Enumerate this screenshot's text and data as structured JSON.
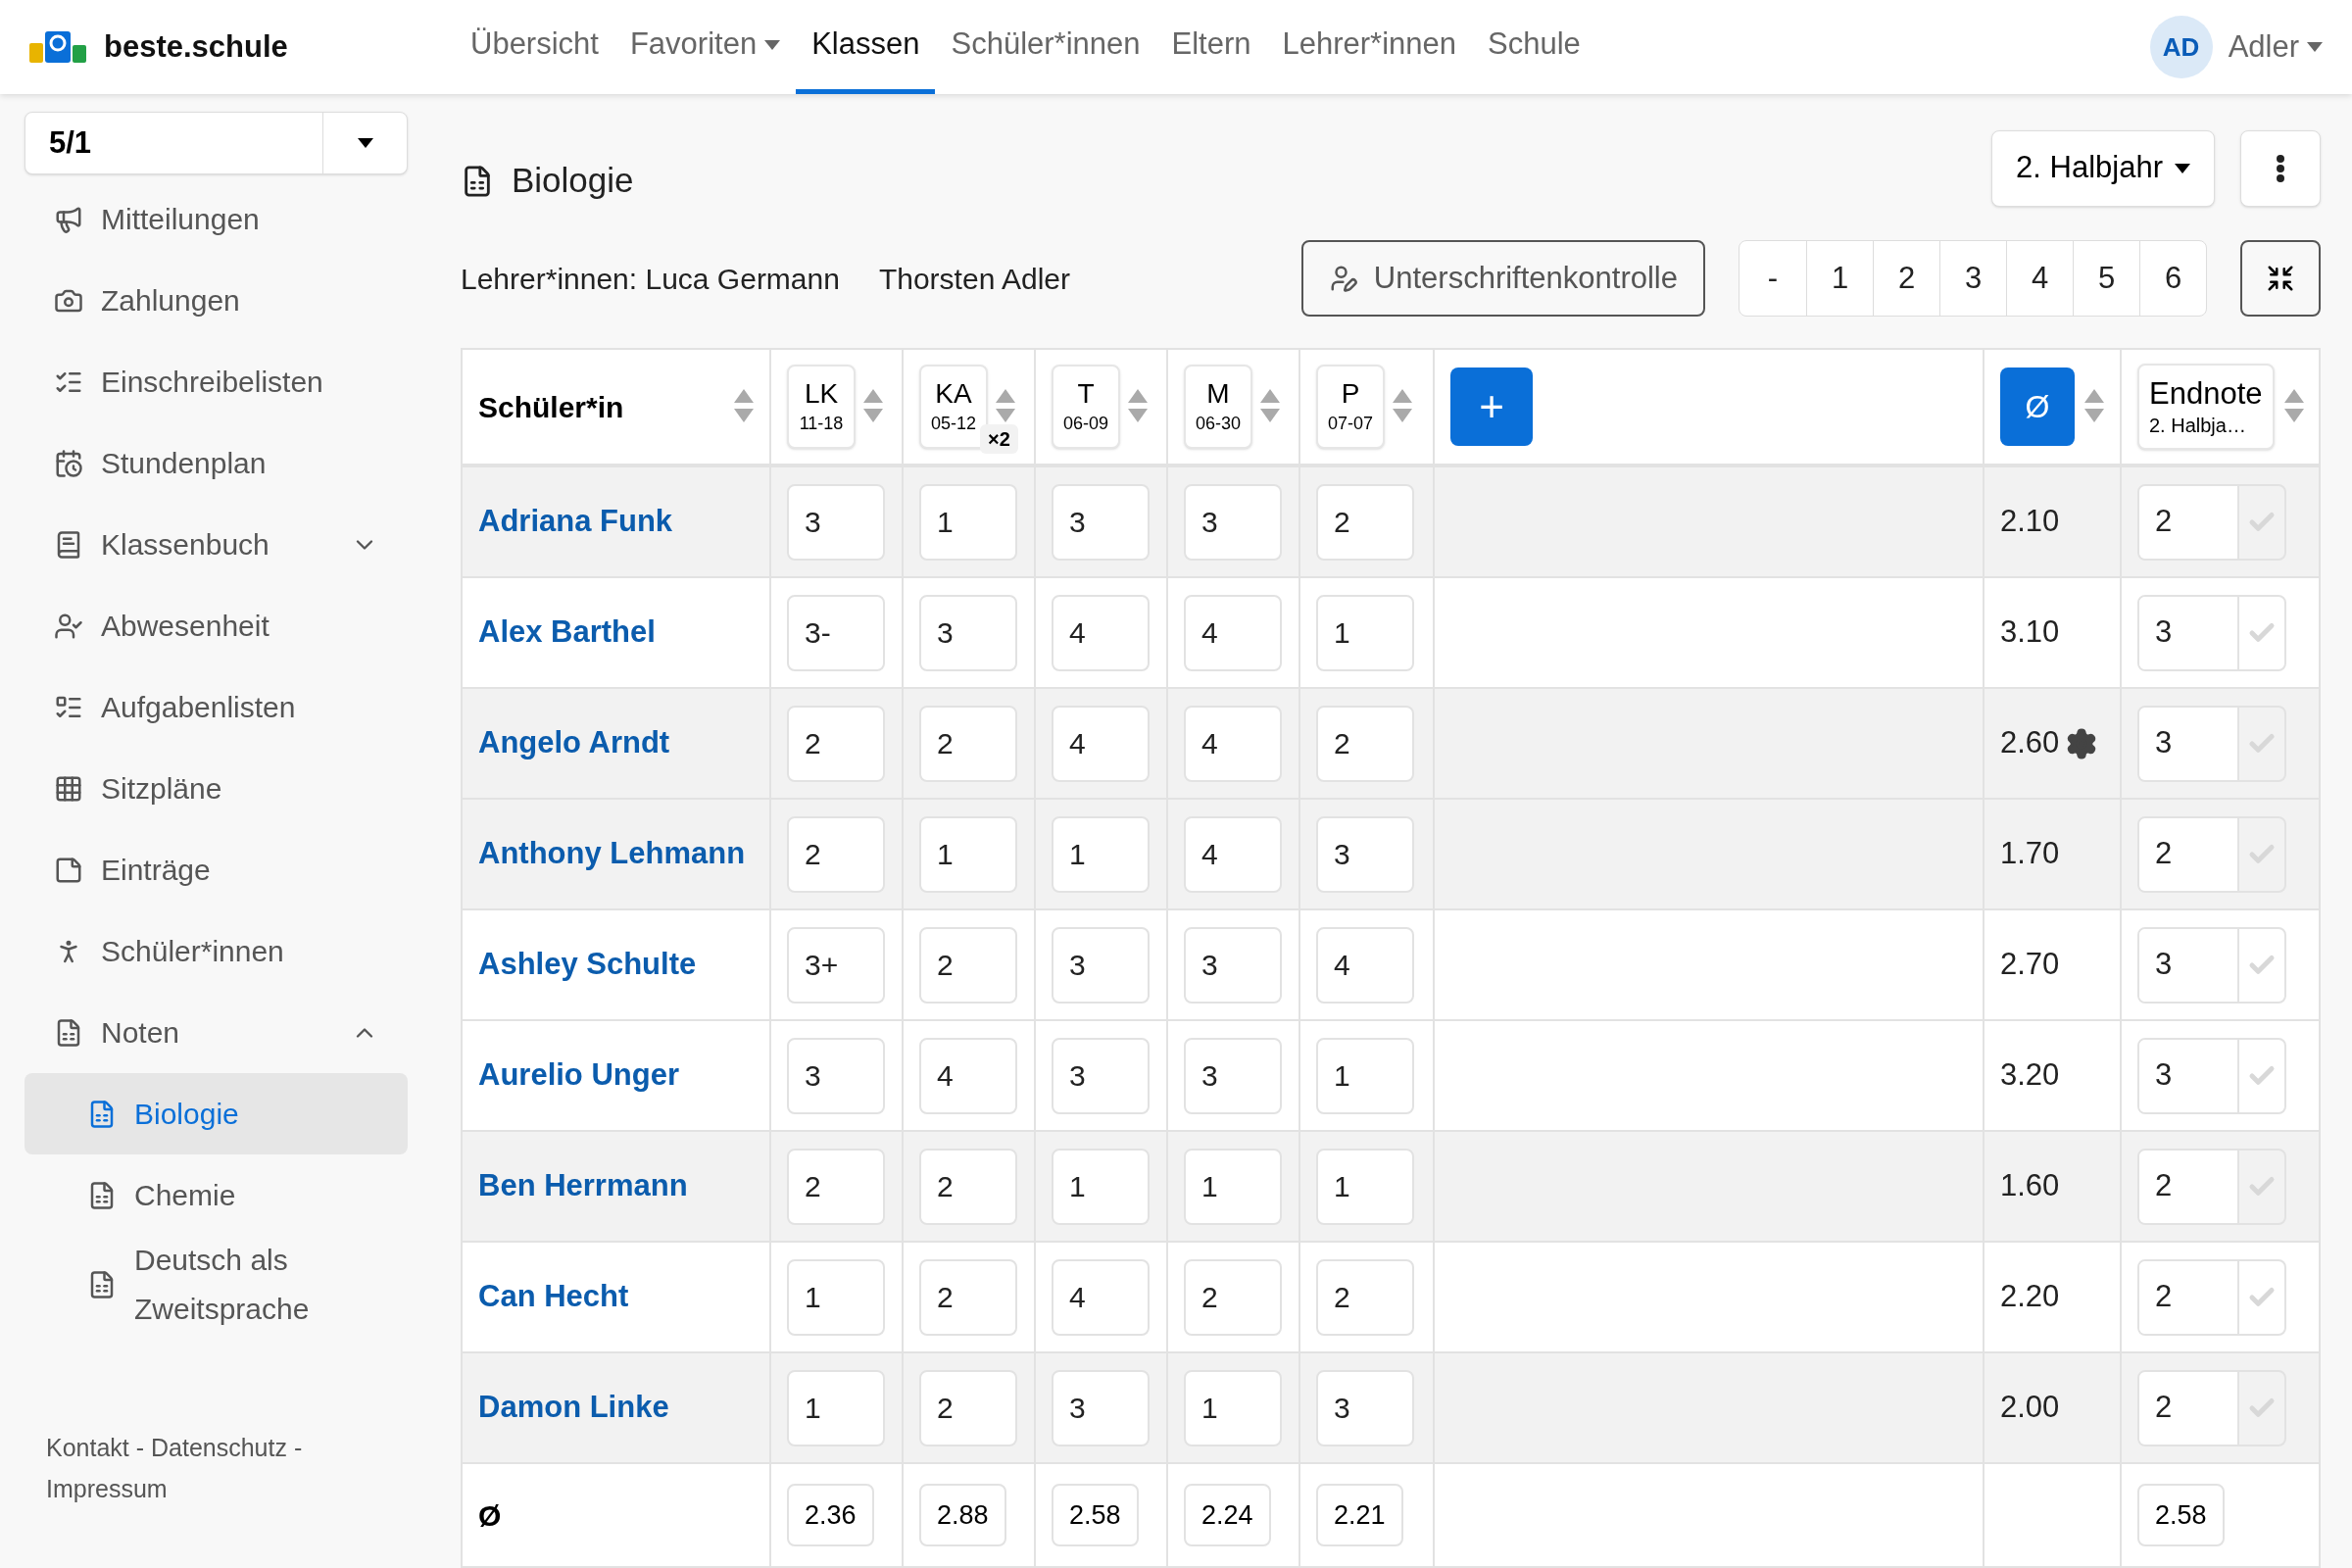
{
  "brand": {
    "name": "beste.schule"
  },
  "nav": [
    {
      "label": "Übersicht",
      "selected": false,
      "dropdown": false
    },
    {
      "label": "Favoriten",
      "selected": false,
      "dropdown": true
    },
    {
      "label": "Klassen",
      "selected": true,
      "dropdown": false
    },
    {
      "label": "Schüler*innen",
      "selected": false,
      "dropdown": false
    },
    {
      "label": "Eltern",
      "selected": false,
      "dropdown": false
    },
    {
      "label": "Lehrer*innen",
      "selected": false,
      "dropdown": false
    },
    {
      "label": "Schule",
      "selected": false,
      "dropdown": false
    }
  ],
  "user": {
    "initials": "AD",
    "name": "Adler"
  },
  "sidebar": {
    "class_select": "5/1",
    "items": [
      {
        "label": "Mitteilungen"
      },
      {
        "label": "Zahlungen"
      },
      {
        "label": "Einschreibelisten"
      },
      {
        "label": "Stundenplan"
      },
      {
        "label": "Klassenbuch",
        "expanded": false
      },
      {
        "label": "Abwesenheit"
      },
      {
        "label": "Aufgabenlisten"
      },
      {
        "label": "Sitzpläne"
      },
      {
        "label": "Einträge"
      },
      {
        "label": "Schüler*innen"
      },
      {
        "label": "Noten",
        "expanded": true,
        "children": [
          {
            "label": "Biologie",
            "selected": true
          },
          {
            "label": "Chemie",
            "selected": false
          },
          {
            "label": "Deutsch als Zweitsprache",
            "selected": false
          }
        ]
      }
    ],
    "footer": "Kontakt - Datenschutz - Impressum"
  },
  "page": {
    "title": "Biologie",
    "semester": "2. Halbjahr",
    "teachers": [
      "Lehrer*innen: Luca Germann",
      "Thorsten Adler"
    ],
    "signature_button": "Unterschriftenkontrolle",
    "pager": [
      "-",
      "1",
      "2",
      "3",
      "4",
      "5",
      "6"
    ]
  },
  "table": {
    "name_header": "Schüler*in",
    "grade_columns": [
      {
        "label": "LK",
        "date": "11-18"
      },
      {
        "label": "KA",
        "date": "05-12",
        "weight": "×2"
      },
      {
        "label": "T",
        "date": "06-09"
      },
      {
        "label": "M",
        "date": "06-30"
      },
      {
        "label": "P",
        "date": "07-07"
      }
    ],
    "add_button": "+",
    "average_header": "Ø",
    "final_header": {
      "label": "Endnote",
      "sub": "2. Halbja…"
    },
    "rows": [
      {
        "name": "Adriana Funk",
        "grades": [
          "3",
          "1",
          "3",
          "3",
          "2"
        ],
        "average": "2.10",
        "adjusted": false,
        "final": "2",
        "shaded": true
      },
      {
        "name": "Alex Barthel",
        "grades": [
          "3-",
          "3",
          "4",
          "4",
          "1"
        ],
        "average": "3.10",
        "adjusted": false,
        "final": "3",
        "shaded": false
      },
      {
        "name": "Angelo Arndt",
        "grades": [
          "2",
          "2",
          "4",
          "4",
          "2"
        ],
        "average": "2.60",
        "adjusted": true,
        "final": "3",
        "shaded": true
      },
      {
        "name": "Anthony Lehmann",
        "grades": [
          "2",
          "1",
          "1",
          "4",
          "3"
        ],
        "average": "1.70",
        "adjusted": false,
        "final": "2",
        "shaded": true
      },
      {
        "name": "Ashley Schulte",
        "grades": [
          "3+",
          "2",
          "3",
          "3",
          "4"
        ],
        "average": "2.70",
        "adjusted": false,
        "final": "3",
        "shaded": false
      },
      {
        "name": "Aurelio Unger",
        "grades": [
          "3",
          "4",
          "3",
          "3",
          "1"
        ],
        "average": "3.20",
        "adjusted": false,
        "final": "3",
        "shaded": false
      },
      {
        "name": "Ben Herrmann",
        "grades": [
          "2",
          "2",
          "1",
          "1",
          "1"
        ],
        "average": "1.60",
        "adjusted": false,
        "final": "2",
        "shaded": true
      },
      {
        "name": "Can Hecht",
        "grades": [
          "1",
          "2",
          "4",
          "2",
          "2"
        ],
        "average": "2.20",
        "adjusted": false,
        "final": "2",
        "shaded": false
      },
      {
        "name": "Damon Linke",
        "grades": [
          "1",
          "2",
          "3",
          "1",
          "3"
        ],
        "average": "2.00",
        "adjusted": false,
        "final": "2",
        "shaded": true
      }
    ],
    "footer": {
      "label": "Ø",
      "averages": [
        "2.36",
        "2.88",
        "2.58",
        "2.24",
        "2.21"
      ],
      "final": "2.58"
    }
  }
}
